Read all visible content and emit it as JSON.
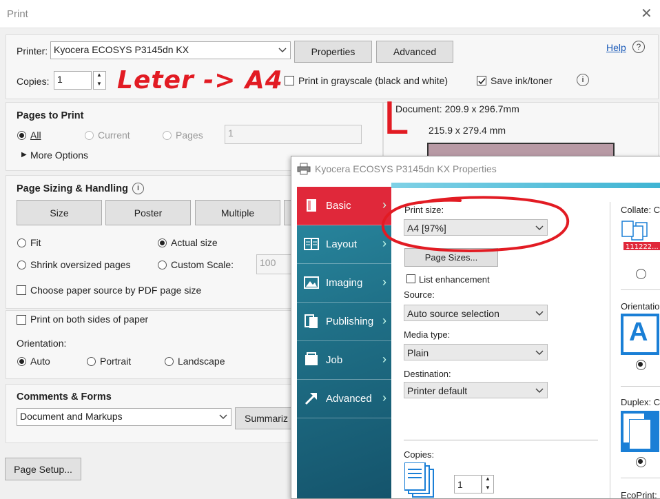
{
  "window": {
    "title": "Print"
  },
  "printer": {
    "label": "Printer:",
    "value": "Kyocera ECOSYS P3145dn KX"
  },
  "buttons": {
    "properties": "Properties",
    "advanced": "Advanced",
    "help": "Help",
    "page_setup": "Page Setup...",
    "summarize": "Summariz"
  },
  "copies": {
    "label": "Copies:",
    "value": "1"
  },
  "annotation": {
    "text": "Leter -> A4",
    "brace": "L"
  },
  "options": {
    "grayscale": "Print in grayscale (black and white)",
    "save_ink": "Save ink/toner"
  },
  "document": {
    "doc_size": "Document: 209.9 x 296.7mm",
    "paper_size": "215.9 x 279.4 mm"
  },
  "pages_to_print": {
    "heading": "Pages to Print",
    "all": "All",
    "current": "Current",
    "pages": "Pages",
    "pages_value": "1",
    "more": "More Options"
  },
  "sizing": {
    "heading": "Page Sizing & Handling",
    "tabs": [
      "Size",
      "Poster",
      "Multiple"
    ],
    "fit": "Fit",
    "actual": "Actual size",
    "shrink": "Shrink oversized pages",
    "custom": "Custom Scale:",
    "custom_value": "100",
    "paper_source": "Choose paper source by PDF page size"
  },
  "duplex": {
    "both_sides": "Print on both sides of paper"
  },
  "orientation": {
    "label": "Orientation:",
    "auto": "Auto",
    "portrait": "Portrait",
    "landscape": "Landscape"
  },
  "comments": {
    "heading": "Comments & Forms",
    "value": "Document and Markups"
  },
  "properties_dialog": {
    "title": "Kyocera ECOSYS P3145dn KX Properties",
    "nav": [
      "Basic",
      "Layout",
      "Imaging",
      "Publishing",
      "Job",
      "Advanced"
    ],
    "print_size": {
      "label": "Print size:",
      "value": "A4  [97%]"
    },
    "page_sizes": "Page Sizes...",
    "list_enhancement": "List enhancement",
    "source": {
      "label": "Source:",
      "value": "Auto source selection"
    },
    "media": {
      "label": "Media type:",
      "value": "Plain"
    },
    "destination": {
      "label": "Destination:",
      "value": "Printer default"
    },
    "copies": {
      "label": "Copies:",
      "value": "1"
    },
    "right": {
      "collate": "Collate: C",
      "orientation": "Orientatio",
      "duplex": "Duplex: C",
      "ecoprint": "EcoPrint:"
    },
    "colors": {
      "nav_active": "#e0283a",
      "accent": "#1a7fd6"
    }
  }
}
